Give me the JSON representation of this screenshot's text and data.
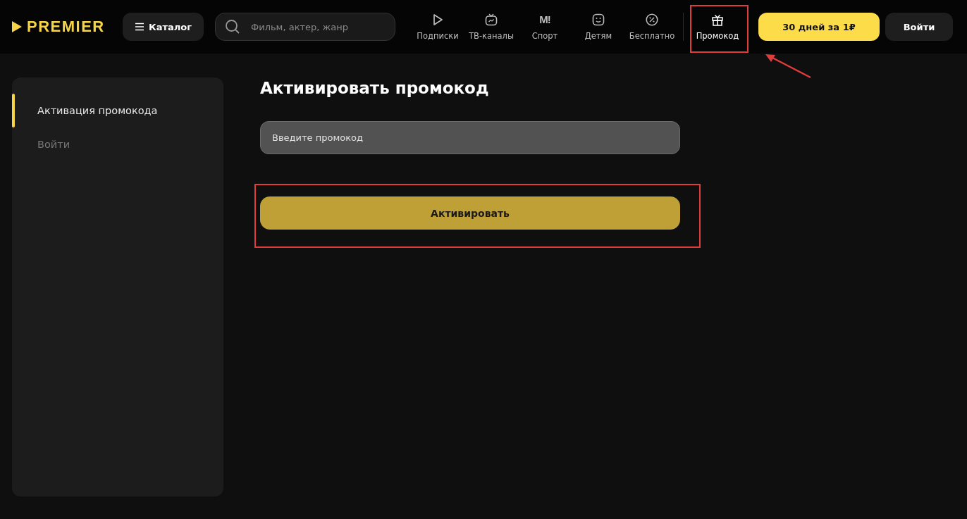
{
  "header": {
    "logo": "PREMIER",
    "catalog_button": "Каталог",
    "search": {
      "placeholder": "Фильм, актер, жанр"
    },
    "nav": [
      {
        "kind": "play",
        "label": "Подписки",
        "selected": false
      },
      {
        "kind": "tv",
        "label": "ТВ-каналы",
        "selected": false
      },
      {
        "kind": "sport",
        "icon_text": "M!",
        "label": "Спорт",
        "selected": false
      },
      {
        "kind": "kids",
        "label": "Детям",
        "selected": false
      },
      {
        "kind": "free",
        "label": "Бесплатно",
        "selected": false
      },
      {
        "kind": "gift",
        "label": "Промокод",
        "selected": true
      }
    ],
    "trial_button": "30 дней за 1₽",
    "login_button": "Войти"
  },
  "sidebar": {
    "items": [
      {
        "label": "Активация промокода",
        "selected": true
      },
      {
        "label": "Войти",
        "selected": false
      }
    ]
  },
  "content": {
    "title": "Активировать промокод",
    "promo_field": {
      "placeholder": "Введите промокод"
    },
    "activate_button": "Активировать"
  }
}
